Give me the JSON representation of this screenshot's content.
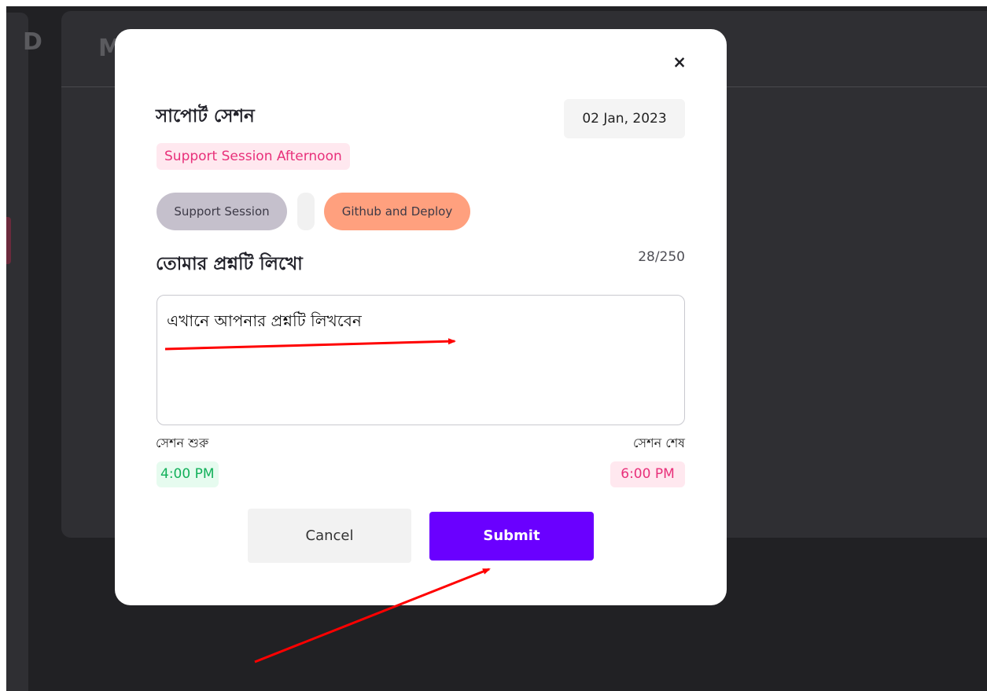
{
  "background": {
    "side_glyph": "D",
    "card_title": "M"
  },
  "modal": {
    "close_icon": "×",
    "title": "সাপোর্ট সেশন",
    "date": "02 Jan, 2023",
    "session_name": "Support Session Afternoon",
    "tags": [
      "Support Session",
      "",
      "Github and Deploy"
    ],
    "question_label": "তোমার প্রশ্নটি লিখো",
    "char_counter": "28/250",
    "question_value": "এখানে আপনার প্রশ্নটি লিখবেন",
    "start_label": "সেশন শুরু",
    "end_label": "সেশন শেষ",
    "start_time": "4:00 PM",
    "end_time": "6:00 PM",
    "cancel_label": "Cancel",
    "submit_label": "Submit"
  },
  "colors": {
    "accent_purple": "#6a00ff",
    "pink": "#e8307a",
    "green": "#12b05a",
    "orange_chip": "#ffa07e",
    "annotation_red": "#ff0000"
  }
}
